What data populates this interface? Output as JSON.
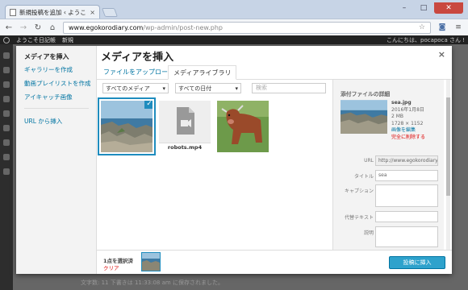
{
  "browser": {
    "tab_title": "新規投稿を追加 ‹ ようこそ日",
    "url_host": "www.egokorodiary.com",
    "url_path": "/wp-admin/post-new.php"
  },
  "adminbar": {
    "site": "ようこそ日記帳",
    "new": "新規",
    "greeting": "こんにちは、pocapoca さん !"
  },
  "footer_text": "文字数: 11   下書きは 11:33:08 am に保存されました。",
  "modal": {
    "title": "メディアを挿入",
    "close": "×",
    "menu": {
      "title": "メディアを挿入",
      "items": [
        "ギャラリーを作成",
        "動画プレイリストを作成",
        "アイキャッチ画像",
        "URL から挿入"
      ]
    },
    "tabs": [
      "ファイルをアップロード",
      "メディアライブラリ"
    ],
    "filters": {
      "media_type": "すべてのメディア",
      "date": "すべての日付",
      "search_placeholder": "検索"
    },
    "attachments": [
      {
        "type": "image",
        "name": "sea.jpg",
        "selected": true
      },
      {
        "type": "video",
        "name": "robots.mp4",
        "selected": false
      },
      {
        "type": "image",
        "name": "cow",
        "selected": false
      }
    ],
    "details": {
      "heading": "添付ファイルの詳細",
      "filename": "sea.jpg",
      "date": "2016年1月8日",
      "size": "2 MB",
      "dimensions": "1728 × 1152",
      "edit_link": "画像を編集",
      "delete_link": "完全に削除する",
      "fields": {
        "url_label": "URL",
        "url_value": "http://www.egokorodiary.",
        "title_label": "タイトル",
        "title_value": "sea",
        "caption_label": "キャプション",
        "alt_label": "代替テキスト",
        "desc_label": "説明"
      }
    },
    "footer": {
      "selection_count": "1点を選択済",
      "clear": "クリア",
      "insert_button": "投稿に挿入"
    }
  }
}
